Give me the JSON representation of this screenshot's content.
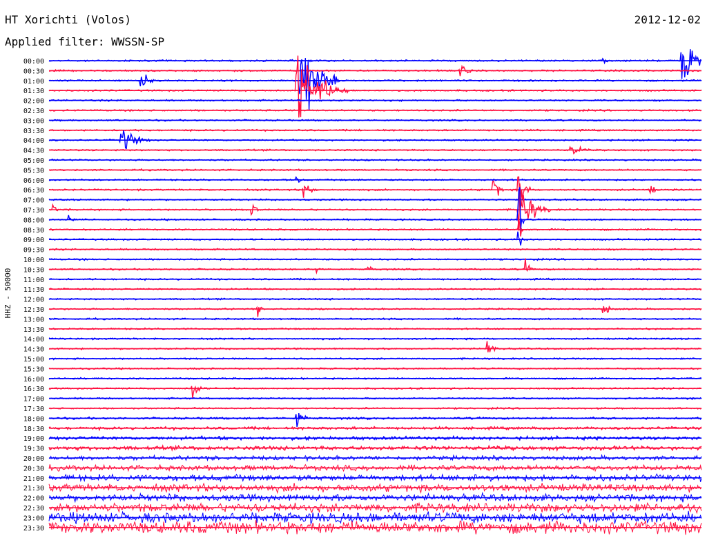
{
  "header": {
    "station": "HT Xorichti (Volos)",
    "filter": "Applied filter: WWSSN-SP",
    "date": "2012-12-02"
  },
  "chart_data": {
    "type": "line",
    "title": "HT Xorichti (Volos)",
    "subtitle": "Applied filter: WWSSN-SP",
    "date": "2012-12-02",
    "ylabel": "HHZ - 50000",
    "tick_labels": [
      "00:00",
      "00:30",
      "01:00",
      "01:30",
      "02:00",
      "02:30",
      "03:00",
      "03:30",
      "04:00",
      "04:30",
      "05:00",
      "05:30",
      "06:00",
      "06:30",
      "07:00",
      "07:30",
      "08:00",
      "08:30",
      "09:00",
      "09:30",
      "10:00",
      "10:30",
      "11:00",
      "11:30",
      "12:00",
      "12:30",
      "13:00",
      "13:30",
      "14:00",
      "14:30",
      "15:00",
      "15:30",
      "16:00",
      "16:30",
      "17:00",
      "17:30",
      "18:00",
      "18:30",
      "19:00",
      "19:30",
      "20:00",
      "20:30",
      "21:00",
      "21:30",
      "22:00",
      "22:30",
      "23:00",
      "23:30"
    ],
    "trace_colors": [
      "#0000ff",
      "#ff1040"
    ],
    "grid": false,
    "events": [
      {
        "row": 0,
        "t": 0.97,
        "amp": 5,
        "dur": 0.05
      },
      {
        "row": 0,
        "t": 0.85,
        "amp": 1.0,
        "dur": 0.01
      },
      {
        "row": 1,
        "t": 0.63,
        "amp": 1.2,
        "dur": 0.03
      },
      {
        "row": 2,
        "t": 0.14,
        "amp": 1.5,
        "dur": 0.04
      },
      {
        "row": 2,
        "t": 0.385,
        "amp": 9,
        "dur": 0.06
      },
      {
        "row": 3,
        "t": 0.38,
        "amp": 7,
        "dur": 0.08
      },
      {
        "row": 8,
        "t": 0.11,
        "amp": 2.5,
        "dur": 0.05
      },
      {
        "row": 9,
        "t": 0.8,
        "amp": 1.2,
        "dur": 0.04
      },
      {
        "row": 12,
        "t": 0.38,
        "amp": 1.5,
        "dur": 0.01
      },
      {
        "row": 13,
        "t": 0.39,
        "amp": 2.5,
        "dur": 0.02
      },
      {
        "row": 13,
        "t": 0.68,
        "amp": 3,
        "dur": 0.02
      },
      {
        "row": 13,
        "t": 0.72,
        "amp": 6,
        "dur": 0.02
      },
      {
        "row": 13,
        "t": 0.92,
        "amp": 1.2,
        "dur": 0.02
      },
      {
        "row": 15,
        "t": 0.005,
        "amp": 2,
        "dur": 0.01
      },
      {
        "row": 15,
        "t": 0.31,
        "amp": 1.5,
        "dur": 0.02
      },
      {
        "row": 15,
        "t": 0.72,
        "amp": 5,
        "dur": 0.05
      },
      {
        "row": 16,
        "t": 0.03,
        "amp": 1.5,
        "dur": 0.01
      },
      {
        "row": 16,
        "t": 0.72,
        "amp": 7,
        "dur": 0.01
      },
      {
        "row": 17,
        "t": 0.72,
        "amp": 4,
        "dur": 0.01
      },
      {
        "row": 18,
        "t": 0.72,
        "amp": 3,
        "dur": 0.01
      },
      {
        "row": 21,
        "t": 0.41,
        "amp": 1.5,
        "dur": 0.01
      },
      {
        "row": 21,
        "t": 0.49,
        "amp": 1.5,
        "dur": 0.01
      },
      {
        "row": 21,
        "t": 0.73,
        "amp": 1.5,
        "dur": 0.02
      },
      {
        "row": 25,
        "t": 0.32,
        "amp": 1.5,
        "dur": 0.01
      },
      {
        "row": 25,
        "t": 0.85,
        "amp": 1.5,
        "dur": 0.02
      },
      {
        "row": 29,
        "t": 0.67,
        "amp": 2.5,
        "dur": 0.02
      },
      {
        "row": 33,
        "t": 0.22,
        "amp": 2.5,
        "dur": 0.02
      },
      {
        "row": 36,
        "t": 0.38,
        "amp": 2.5,
        "dur": 0.02
      }
    ]
  }
}
